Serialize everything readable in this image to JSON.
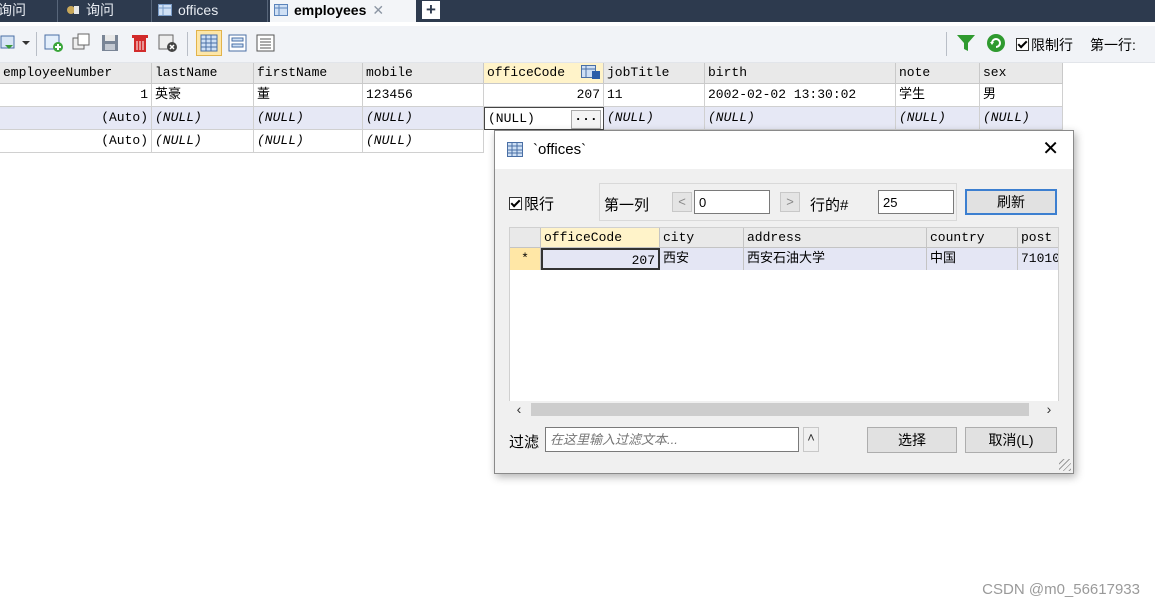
{
  "tabs": [
    {
      "label": "询问",
      "icon": "query-icon",
      "active": false
    },
    {
      "label": "询问",
      "icon": "query-icon",
      "active": false
    },
    {
      "label": "offices",
      "icon": "table-icon",
      "active": false
    },
    {
      "label": "employees",
      "icon": "table-icon",
      "active": true,
      "close": "✕"
    }
  ],
  "toolbar": {
    "limit_rows_label": "限制行",
    "first_row_label": "第一行:",
    "limit_checked": true
  },
  "grid": {
    "columns": [
      "employeeNumber",
      "lastName",
      "firstName",
      "mobile",
      "officeCode",
      "jobTitle",
      "birth",
      "note",
      "sex"
    ],
    "rows": [
      [
        "1",
        "英豪",
        "董",
        "123456",
        "207",
        "11",
        "2002-02-02 13:30:02",
        "学生",
        "男"
      ],
      [
        "(Auto)",
        "(NULL)",
        "(NULL)",
        "(NULL)",
        "(NULL)",
        "(NULL)",
        "(NULL)",
        "(NULL)",
        "(NULL)"
      ],
      [
        "(Auto)",
        "(NULL)",
        "(NULL)",
        "(NULL)",
        "",
        "",
        "",
        "",
        ""
      ]
    ],
    "lookup_button": "..."
  },
  "dialog": {
    "title": "`offices`",
    "limit_label": "限行",
    "limit_checked": true,
    "first_col_label": "第一列",
    "first_col_value": "0",
    "rows_label": "行的#",
    "rows_value": "25",
    "refresh_label": "刷新",
    "columns": [
      "officeCode",
      "city",
      "address",
      "country",
      "post"
    ],
    "rows": [
      {
        "marker": "*",
        "cells": [
          "207",
          "西安",
          "西安石油大学",
          "中国",
          "71010"
        ]
      }
    ],
    "filter_label": "过滤",
    "filter_placeholder": "在这里输入过滤文本...",
    "filter_arrow": "˄",
    "select_label": "选择",
    "cancel_label": "取消(L)"
  },
  "watermark": "CSDN @m0_56617933",
  "colors": {
    "tabbar": "#2d3a4e",
    "selected_header": "#fff3c9",
    "selected_row": "#e6e8f5",
    "accent": "#3c7fd0"
  }
}
